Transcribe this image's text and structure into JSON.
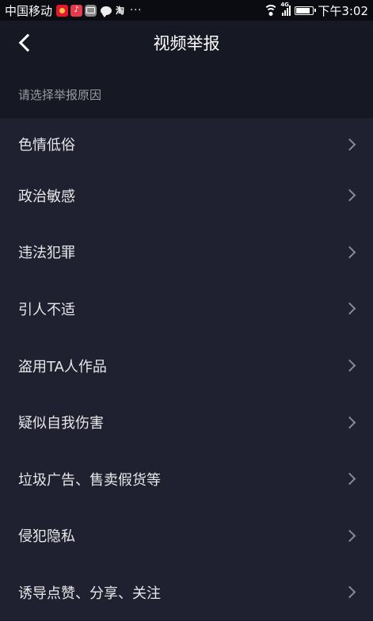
{
  "status_bar": {
    "carrier": "中国移动",
    "taobao": "淘",
    "more": "···",
    "network": "4G",
    "time": "下午3:02"
  },
  "header": {
    "title": "视频举报"
  },
  "section": {
    "label": "请选择举报原因"
  },
  "reasons": [
    {
      "label": "色情低俗"
    },
    {
      "label": "政治敏感"
    },
    {
      "label": "违法犯罪"
    },
    {
      "label": "引人不适"
    },
    {
      "label": "盗用TA人作品"
    },
    {
      "label": "疑似自我伤害"
    },
    {
      "label": "垃圾广告、售卖假货等"
    },
    {
      "label": "侵犯隐私"
    },
    {
      "label": "诱导点赞、分享、关注"
    }
  ],
  "colors": {
    "background": "#161823",
    "list_background": "#1f2030",
    "text_primary": "#ffffff",
    "text_secondary": "#9a9ba2",
    "arrow": "#8a8b94"
  },
  "icons": {
    "back": "chevron-left-icon",
    "row_arrow": "chevron-right-icon"
  }
}
